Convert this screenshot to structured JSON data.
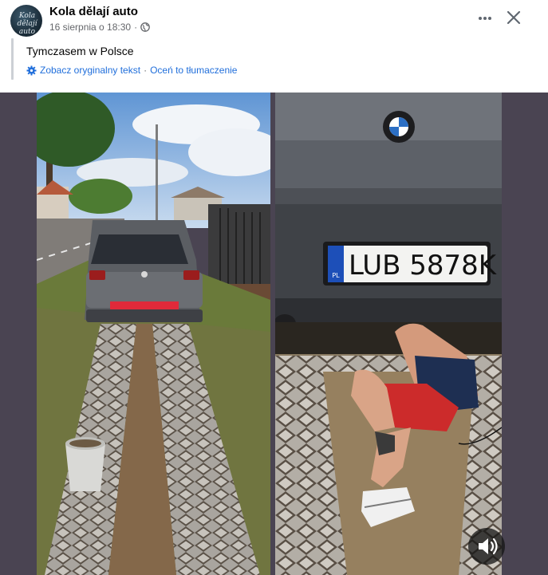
{
  "post": {
    "page_name": "Kola dělají auto",
    "avatar_text": "Kola dělají auto",
    "timestamp": "16 sierpnia o 18:30",
    "separator": "·",
    "text": "Tymczasem w Polsce",
    "see_original": "Zobacz oryginalny tekst",
    "rate_translation": "Oceń to tłumaczenie"
  },
  "photo_right": {
    "plate_number": "LUB 5878K",
    "plate_country": "PL"
  },
  "icons": {
    "privacy": "globe-icon",
    "more": "more-options-icon",
    "close": "close-icon",
    "translate": "gear-icon",
    "sound": "speaker-icon"
  }
}
